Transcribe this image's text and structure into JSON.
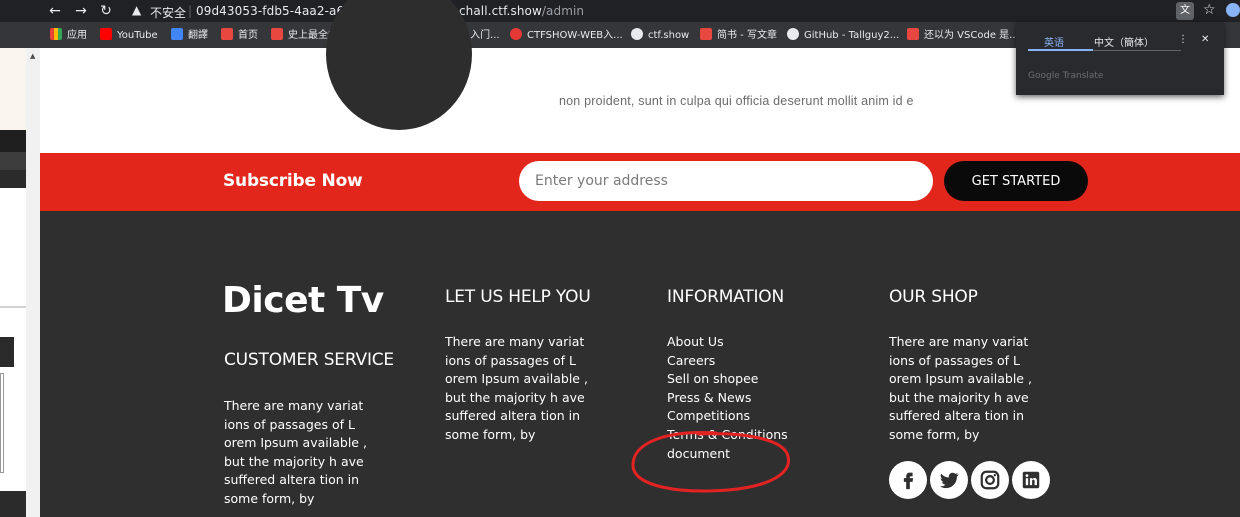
{
  "browser": {
    "nav": {
      "back": "←",
      "forward": "→",
      "reload": "↻"
    },
    "insecure_label": "不安全",
    "url_host": "09d43053-fdb5-4aa2-a6d5-a429a9de830c.chall.ctf.show",
    "url_path": "/admin",
    "icons": [
      "warning-icon",
      "translate-icon",
      "star-icon",
      "profile-icon"
    ]
  },
  "bookmarks": [
    {
      "label": "应用",
      "color": "#ea4335"
    },
    {
      "label": "YouTube",
      "color": "#ff0000"
    },
    {
      "label": "翻譯",
      "color": "#4285f4"
    },
    {
      "label": "首页",
      "color": "#e8473f"
    },
    {
      "label": "史上最全的Nginx...",
      "color": "#e8473f"
    },
    {
      "label": "ctfshow-web入门...",
      "color": "#4fa3f7"
    },
    {
      "label": "CTFSHOW-WEB入...",
      "color": "#e53935"
    },
    {
      "label": "ctf.show",
      "color": "#e8eaed"
    },
    {
      "label": "简书 - 写文章",
      "color": "#e8473f"
    },
    {
      "label": "GitHub - Tallguy2...",
      "color": "#e8eaed"
    },
    {
      "label": "还以为 VSCode 是...",
      "color": "#e8473f"
    }
  ],
  "translate_popup": {
    "tab_source": "英语",
    "tab_target": "中文（簡体）",
    "more": "⋮",
    "close": "✕",
    "footer": "Google Translate"
  },
  "page": {
    "lorem_line": "non proident, sunt in culpa qui officia deserunt mollit anim id e"
  },
  "subscribe": {
    "title": "Subscribe Now",
    "placeholder": "Enter your address",
    "button": "GET STARTED",
    "accent": "#e3261b"
  },
  "footer": {
    "brand": "Dicet Tv",
    "customer_service": {
      "heading": "CUSTOMER SERVICE",
      "text": "There are many variat ions of passages of L orem Ipsum available , but the majority h ave suffered altera tion in some form, by"
    },
    "help": {
      "heading": "LET US HELP YOU",
      "text": "There are many variat ions of passages of L orem Ipsum available , but the majority h ave suffered altera tion in some form, by"
    },
    "information": {
      "heading": "INFORMATION",
      "links": [
        "About Us",
        "Careers",
        "Sell on shopee",
        "Press & News",
        "Competitions",
        "Terms & Conditions",
        "document"
      ]
    },
    "shop": {
      "heading": "OUR SHOP",
      "text": "There are many variat ions of passages of L orem Ipsum available , but the majority h ave suffered altera tion in some form, by"
    },
    "socials": [
      "facebook-icon",
      "twitter-icon",
      "instagram-icon",
      "linkedin-icon"
    ],
    "bg": "#2f2f2f"
  },
  "annotation": {
    "color": "#e32222"
  }
}
